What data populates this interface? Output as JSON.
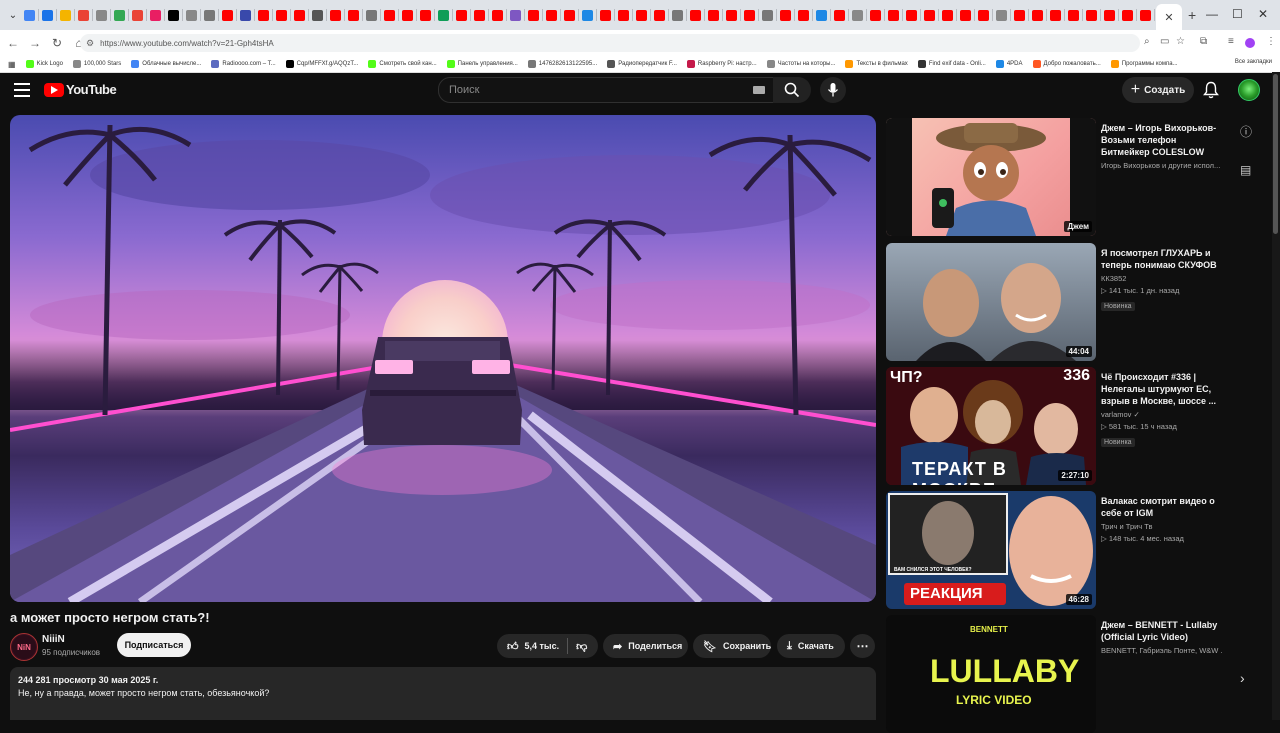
{
  "browser": {
    "url": "https://www.youtube.com/watch?v=21-Gph4tsHA",
    "bookmarks": [
      "Kick Logo",
      "100,000 Stars",
      "Облачные вычисле...",
      "Radioooo.com – T...",
      "Cqp/MFFXf.g/AQQzT...",
      "Смотреть свой кан...",
      "Панель управления...",
      "1476282613122595...",
      "Радиопередатчик F...",
      "Raspberry Pi: настр...",
      "Частоты на которы...",
      "Тексты в фильмах",
      "Find exif data - Onli...",
      "4PDA",
      "Добро пожаловать...",
      "Программы компа..."
    ],
    "all_bookmarks_label": "Все закладки"
  },
  "header": {
    "logo_text": "YouTube",
    "search_placeholder": "Поиск",
    "create_label": "Создать"
  },
  "video": {
    "title": "а может просто негром стать?!",
    "channel": "NiiiN",
    "subscribers": "95 подписчиков",
    "subscribe_label": "Подписаться",
    "likes": "5,4 тыс.",
    "share_label": "Поделиться",
    "save_label": "Сохранить",
    "download_label": "Скачать",
    "views_date": "244 281 просмотр  30 мая 2025 г.",
    "description": "Не, ну а правда, может просто негром стать, обезьяночкой?"
  },
  "recommendations": [
    {
      "title": "Джем – Игорь Вихорьков-Возьми телефон Битмейкер COLESLOW",
      "channel": "Игорь Вихорьков и другие испол...",
      "meta": "",
      "badge": "",
      "duration": "Джем"
    },
    {
      "title": "Я посмотрел ГЛУХАРЬ и теперь понимаю СКУФОВ",
      "channel": "КК3852",
      "meta": "▷ 141 тыс.  1 дн. назад",
      "badge": "Новинка",
      "duration": "44:04"
    },
    {
      "title": "Чё Происходит #336 | Нелегалы штурмуют ЕС, взрыв в Москве, шоссе ...",
      "channel": "varlamov ✓",
      "meta": "▷ 581 тыс.  15 ч назад",
      "badge": "Новинка",
      "duration": "2:27:10"
    },
    {
      "title": "Валакас смотрит видео о себе от IGM",
      "channel": "Трич и Трич Тв",
      "meta": "▷ 148 тыс.  4 мес. назад",
      "badge": "",
      "duration": "46:28"
    },
    {
      "title": "Джем – BENNETT - Lullaby (Official Lyric Video)",
      "channel": "BENNETT, Габриэль Понте, W&W ...",
      "meta": "",
      "badge": "",
      "duration": ""
    }
  ],
  "thumb_texts": {
    "t3_left": "ЧП?",
    "t3_num": "336",
    "t3_banner": "ТЕРАКТ В МОСКВЕ",
    "t4_banner": "РЕАКЦИЯ",
    "t4_q": "ВАМ СНИЛСЯ ЭТОТ ЧЕЛОВЕК?",
    "t5_top": "BENNETT",
    "t5_main": "LULLABY",
    "t5_sub": "LYRIC VIDEO"
  },
  "colors": {
    "brand_red": "#ff0000",
    "bg": "#0f0f0f",
    "pill": "#272727"
  }
}
